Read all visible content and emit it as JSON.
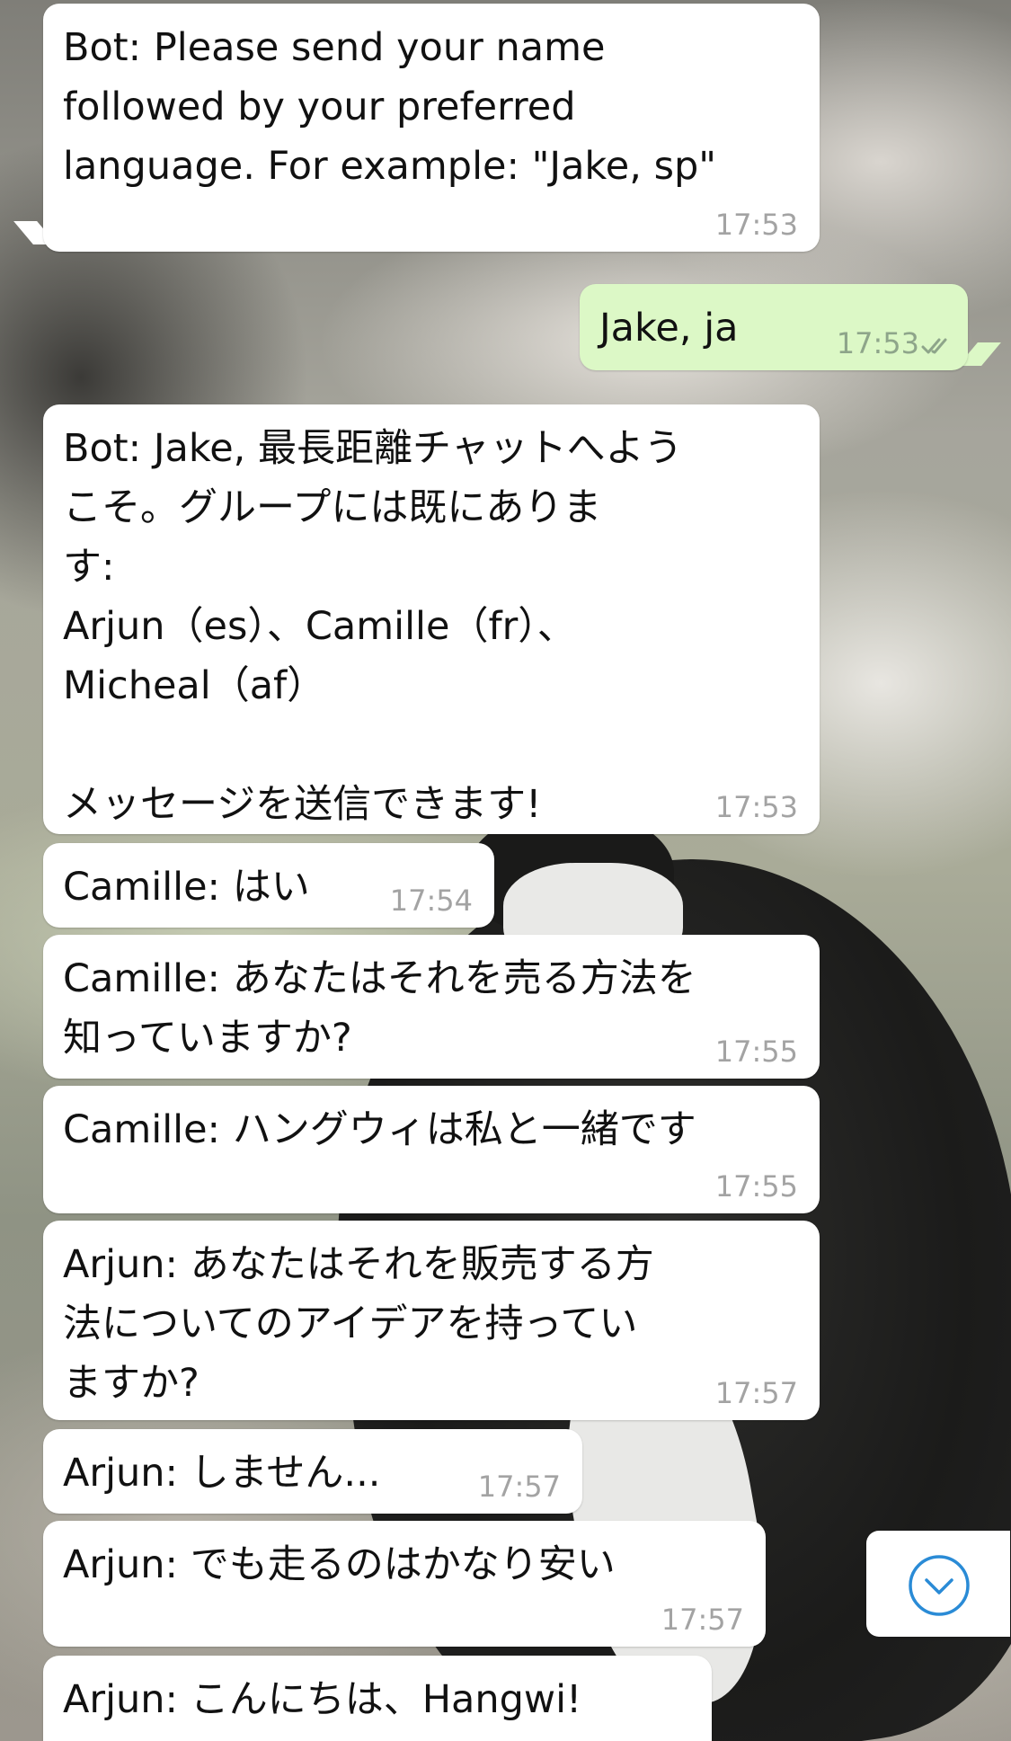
{
  "messages": [
    {
      "text": "Bot: Please send your name\nfollowed by your preferred\nlanguage. For example: \"Jake, sp\"",
      "time": "17:53",
      "direction": "incoming"
    },
    {
      "text": "Jake, ja",
      "time": "17:53",
      "direction": "outgoing",
      "status_icon": "double-check-icon"
    },
    {
      "text": "Bot: Jake, 最長距離チャットへよう\nこそ。グループには既にありま\nす:\nArjun（es）、Camille（fr）、\nMicheal（af）\n\nメッセージを送信できます!",
      "time": "17:53",
      "direction": "incoming"
    },
    {
      "text": "Camille: はい",
      "time": "17:54",
      "direction": "incoming"
    },
    {
      "text": "Camille: あなたはそれを売る方法を\n知っていますか?",
      "time": "17:55",
      "direction": "incoming"
    },
    {
      "text": "Camille: ハングウィは私と一緒です",
      "time": "17:55",
      "direction": "incoming"
    },
    {
      "text": "Arjun: あなたはそれを販売する方\n法についてのアイデアを持ってい\nますか?",
      "time": "17:57",
      "direction": "incoming"
    },
    {
      "text": "Arjun: しません...",
      "time": "17:57",
      "direction": "incoming"
    },
    {
      "text": "Arjun: でも走るのはかなり安い",
      "time": "17:57",
      "direction": "incoming"
    },
    {
      "text": "Arjun: こんにちは、Hangwi!",
      "time": "",
      "direction": "incoming"
    }
  ],
  "scroll_button": {
    "icon": "chevron-down-circle-icon"
  },
  "colors": {
    "incoming_bubble": "#ffffff",
    "outgoing_bubble": "#dcf8c6",
    "timestamp": "#a3a3a3",
    "accent": "#2a8bd6"
  }
}
